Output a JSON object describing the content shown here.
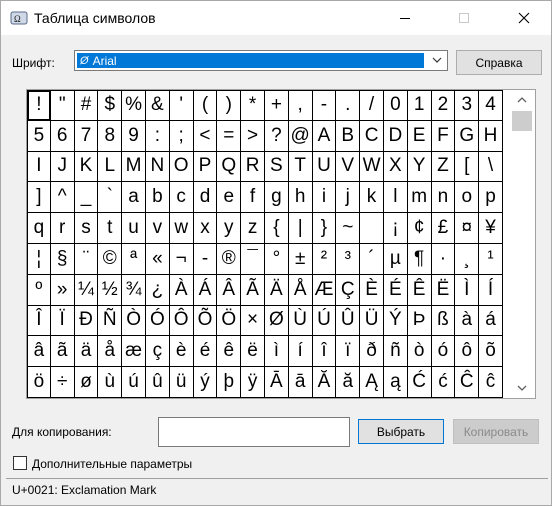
{
  "window": {
    "title": "Таблица символов",
    "icon": "charmap-icon"
  },
  "font": {
    "label": "Шрифт:",
    "selected": "Arial",
    "help_label": "Справка"
  },
  "grid": {
    "selected_index": 0,
    "chars": [
      "!",
      "\"",
      "#",
      "$",
      "%",
      "&",
      "'",
      "(",
      ")",
      "*",
      "+",
      ",",
      "-",
      ".",
      "/",
      "0",
      "1",
      "2",
      "3",
      "4",
      "5",
      "6",
      "7",
      "8",
      "9",
      ":",
      ";",
      "<",
      "=",
      ">",
      "?",
      "@",
      "A",
      "B",
      "C",
      "D",
      "E",
      "F",
      "G",
      "H",
      "I",
      "J",
      "K",
      "L",
      "M",
      "N",
      "O",
      "P",
      "Q",
      "R",
      "S",
      "T",
      "U",
      "V",
      "W",
      "X",
      "Y",
      "Z",
      "[",
      "\\",
      "]",
      "^",
      "_",
      "`",
      "a",
      "b",
      "c",
      "d",
      "e",
      "f",
      "g",
      "h",
      "i",
      "j",
      "k",
      "l",
      "m",
      "n",
      "o",
      "p",
      "q",
      "r",
      "s",
      "t",
      "u",
      "v",
      "w",
      "x",
      "y",
      "z",
      "{",
      "|",
      "}",
      "~",
      " ",
      "¡",
      "¢",
      "£",
      "¤",
      "¥",
      "¦",
      "§",
      "¨",
      "©",
      "ª",
      "«",
      "¬",
      "-",
      "®",
      "¯",
      "°",
      "±",
      "²",
      "³",
      "´",
      "µ",
      "¶",
      "·",
      "¸",
      "¹",
      "º",
      "»",
      "¼",
      "½",
      "¾",
      "¿",
      "À",
      "Á",
      "Â",
      "Ã",
      "Ä",
      "Å",
      "Æ",
      "Ç",
      "È",
      "É",
      "Ê",
      "Ë",
      "Ì",
      "Í",
      "Î",
      "Ï",
      "Ð",
      "Ñ",
      "Ò",
      "Ó",
      "Ô",
      "Õ",
      "Ö",
      "×",
      "Ø",
      "Ù",
      "Ú",
      "Û",
      "Ü",
      "Ý",
      "Þ",
      "ß",
      "à",
      "á",
      "â",
      "ã",
      "ä",
      "å",
      "æ",
      "ç",
      "è",
      "é",
      "ê",
      "ë",
      "ì",
      "í",
      "î",
      "ï",
      "ð",
      "ñ",
      "ò",
      "ó",
      "ô",
      "õ",
      "ö",
      "÷",
      "ø",
      "ù",
      "ú",
      "û",
      "ü",
      "ý",
      "þ",
      "ÿ",
      "Ā",
      "ā",
      "Ă",
      "ă",
      "Ą",
      "ą",
      "Ć",
      "ć",
      "Ĉ",
      "ĉ"
    ]
  },
  "copy": {
    "label": "Для копирования:",
    "value": "",
    "select_label": "Выбрать",
    "copy_label": "Копировать"
  },
  "advanced": {
    "label": "Дополнительные параметры",
    "checked": false
  },
  "status": {
    "text": "U+0021: Exclamation Mark"
  }
}
